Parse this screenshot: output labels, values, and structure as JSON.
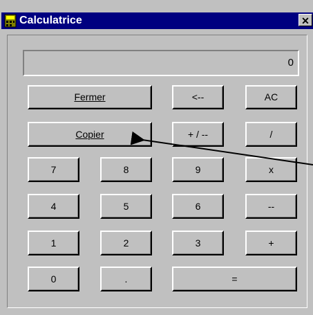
{
  "window": {
    "title": "Calculatrice",
    "close": "✕"
  },
  "display": {
    "value": "0"
  },
  "buttons": {
    "fermer": "Fermer",
    "copier": "Copier",
    "backspace": "<--",
    "ac": "AC",
    "plusminus": "+ / --",
    "divide": "/",
    "n7": "7",
    "n8": "8",
    "n9": "9",
    "multiply": "x",
    "n4": "4",
    "n5": "5",
    "n6": "6",
    "minus": "--",
    "n1": "1",
    "n2": "2",
    "n3": "3",
    "plus": "+",
    "n0": "0",
    "dot": ".",
    "equals": "="
  },
  "colors": {
    "titlebar": "#000080",
    "face": "#c0c0c0"
  },
  "icons": {
    "app": "calculator-icon",
    "annotation": "arrow-pointer-icon"
  }
}
